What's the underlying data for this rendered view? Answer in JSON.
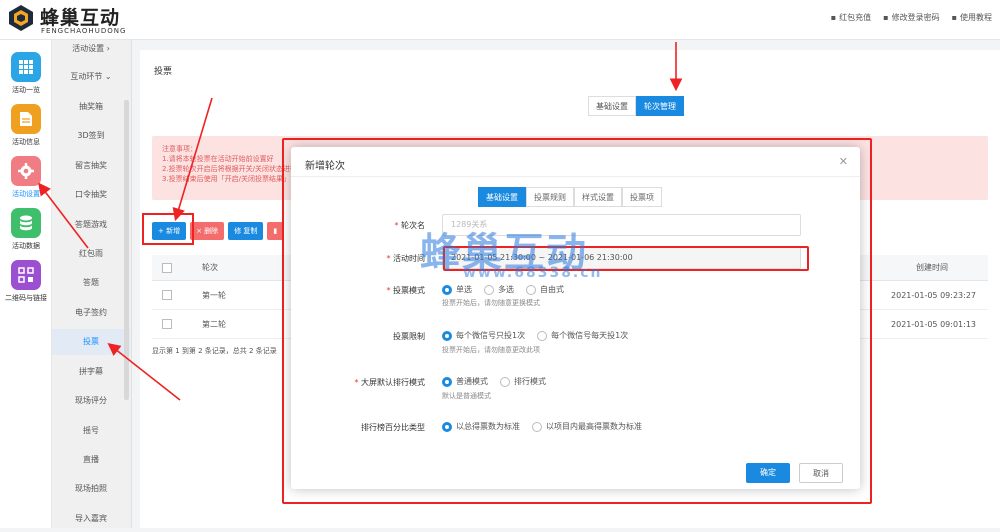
{
  "brand": {
    "title": "蜂巢互动",
    "subtitle": "FENGCHAOHUDONG"
  },
  "top_links": [
    "红包充值",
    "修改登录密码",
    "使用教程"
  ],
  "rail": [
    {
      "label": "活动一览",
      "icon": "grid-icon",
      "color": "#2aa6e6"
    },
    {
      "label": "活动信息",
      "icon": "document-icon",
      "color": "#f0a020"
    },
    {
      "label": "活动设置",
      "icon": "gear-icon",
      "color": "#f07c84"
    },
    {
      "label": "活动数据",
      "icon": "database-icon",
      "color": "#3fbf6b"
    },
    {
      "label": "二维码与链接",
      "icon": "qrcode-icon",
      "color": "#9b4fd1"
    }
  ],
  "submenu": [
    "活动设置 ›",
    "互动环节 ⌄",
    "抽奖箱",
    "3D签到",
    "留言抽奖",
    "口令抽奖",
    "答题游戏",
    "红包雨",
    "答题",
    "电子签约",
    "投票",
    "拼字幕",
    "现场评分",
    "摇号",
    "直播",
    "现场拍照",
    "导入嘉宾"
  ],
  "main": {
    "title": "投票",
    "tabs": [
      "基础设置",
      "轮次管理"
    ],
    "notice_lines": [
      "注意事项：",
      "1.请将本轮投票在活动开始前设置好",
      "2.投票轮次开启后将根据开关/关闭状态进行",
      "3.投票结束后使用「开启/关闭投票结果」"
    ],
    "toolbar": [
      {
        "label": "+ 新增",
        "color": "#1a8ae0"
      },
      {
        "label": "× 删除",
        "color": "#f56c6c"
      },
      {
        "label": "修 复制",
        "color": "#1a8ae0"
      },
      {
        "label": "▮",
        "color": "#f56c6c"
      }
    ],
    "table": {
      "headers": [
        "轮次",
        "创建时间"
      ],
      "rows": [
        {
          "name": "第一轮",
          "time": "2021-01-05 09:23:27"
        },
        {
          "name": "第二轮",
          "time": "2021-01-05 09:01:13"
        }
      ]
    },
    "pagination": "显示第 1 到第 2 条记录，总共 2 条记录"
  },
  "dialog": {
    "title": "新增轮次",
    "tabs": [
      "基础设置",
      "投票规则",
      "样式设置",
      "投票项"
    ],
    "fields": {
      "name": {
        "label": "轮次名",
        "placeholder": "1289关系"
      },
      "time": {
        "label": "活动时间",
        "value": "2021-01-05 21:30:00 ~ 2021-01-06 21:30:00"
      },
      "mode": {
        "label": "投票模式",
        "options": [
          "单选",
          "多选",
          "自由式"
        ],
        "hint": "投票开始后，请勿随意更换模式"
      },
      "limit": {
        "label": "投票限制",
        "options": [
          "每个微信号只投1次",
          "每个微信号每天投1次"
        ],
        "hint": "投票开始后，请勿随意更改此项"
      },
      "screen": {
        "label": "大屏默认排行模式",
        "options": [
          "普通模式",
          "排行模式"
        ],
        "hint": "默认是普通模式"
      },
      "percent": {
        "label": "排行榜百分比类型",
        "options": [
          "以总得票数为标准",
          "以项目内最高得票数为标准"
        ]
      }
    },
    "ok": "确定",
    "cancel": "取消"
  },
  "watermark": {
    "text": "蜂巢互动",
    "url": "www.68338.cn"
  }
}
